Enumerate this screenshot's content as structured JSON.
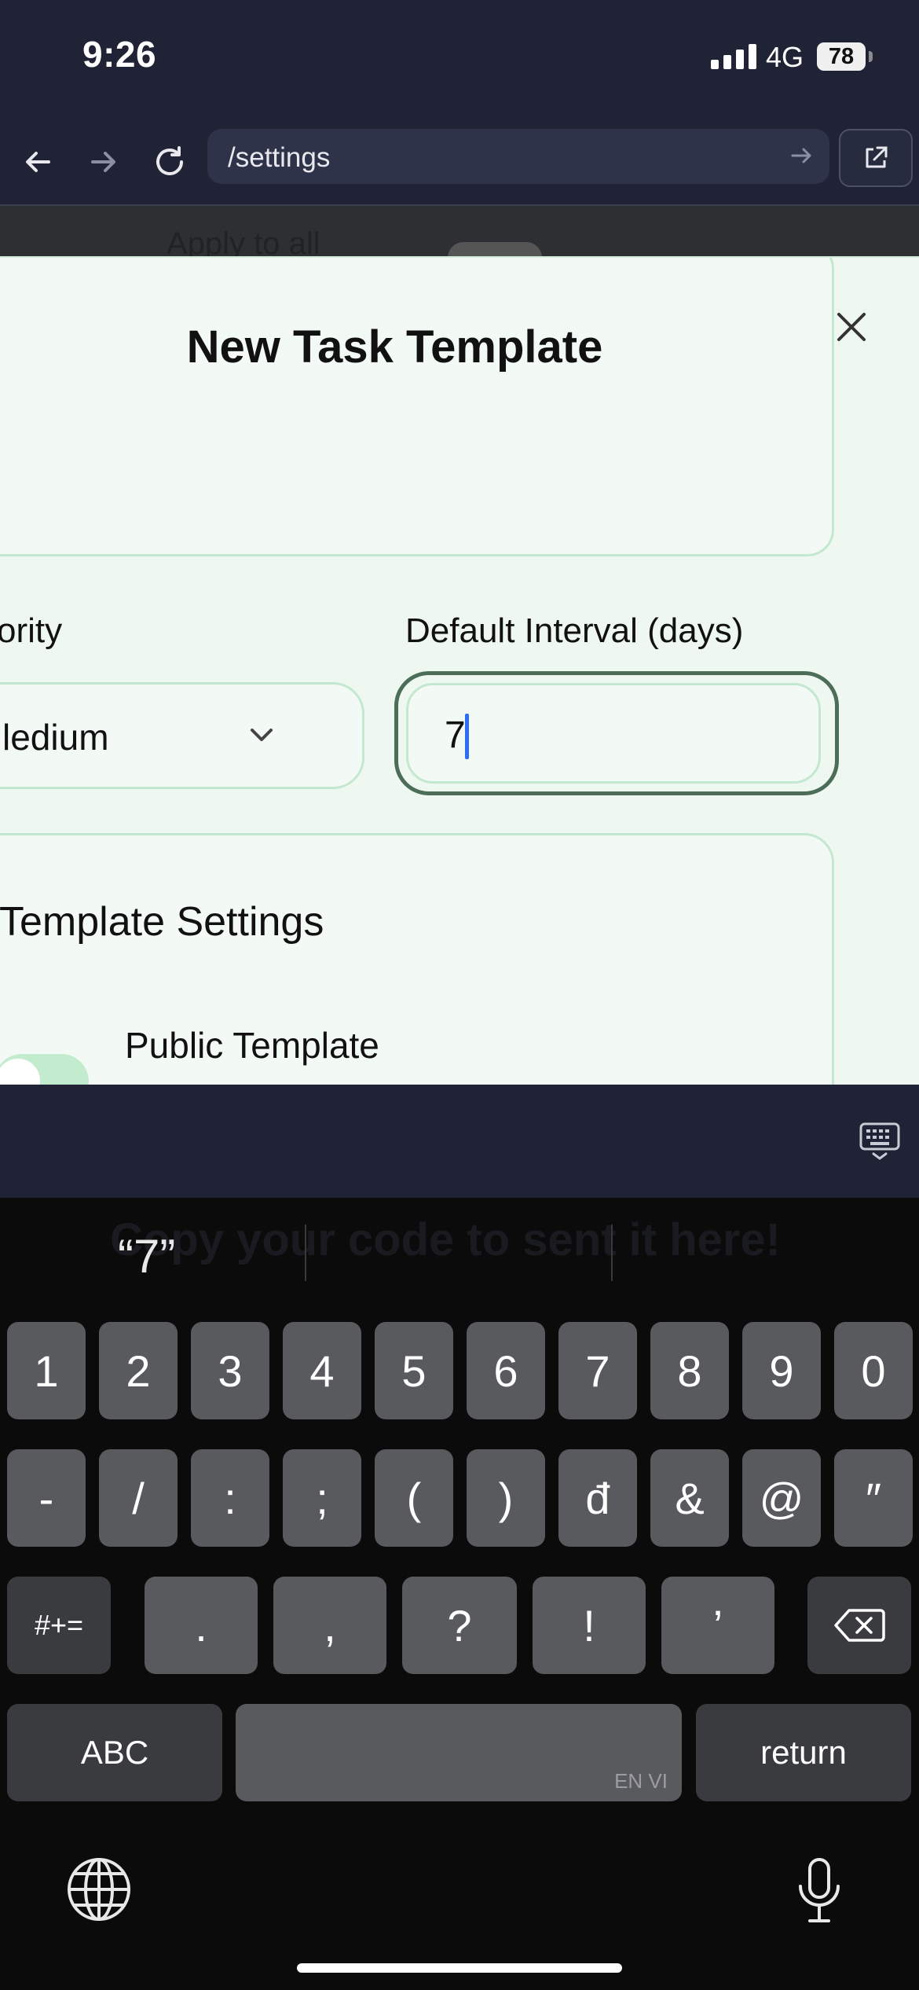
{
  "status_bar": {
    "time": "9:26",
    "network": "4G",
    "battery": "78"
  },
  "browser": {
    "url": "/settings"
  },
  "background": {
    "partial_text": "Apply to all"
  },
  "modal": {
    "title": "New Task Template",
    "priority": {
      "label": "Priority",
      "label_visible": "ority",
      "value": "Medium",
      "value_visible": "ledium"
    },
    "interval": {
      "label": "Default Interval (days)",
      "value": "7"
    },
    "template_settings": {
      "title_visible": "Template Settings",
      "public_label": "Public Template"
    }
  },
  "keyboard": {
    "ghost_text": "Copy your code to sent it here!",
    "suggestion": "“7”",
    "row1": [
      "1",
      "2",
      "3",
      "4",
      "5",
      "6",
      "7",
      "8",
      "9",
      "0"
    ],
    "row2": [
      "-",
      "/",
      ":",
      ";",
      "(",
      ")",
      "đ",
      "&",
      "@",
      "″"
    ],
    "row3": [
      "#+=",
      ".",
      ",",
      "?",
      "!",
      "’"
    ],
    "abc_label": "ABC",
    "space_lang": "EN VI",
    "return_label": "return"
  },
  "icons": {
    "back": "back-arrow-icon",
    "forward": "forward-arrow-icon",
    "reload": "reload-icon",
    "external": "external-link-icon",
    "close": "close-icon",
    "chevron": "chevron-down-icon",
    "keyboard_dismiss": "keyboard-dismiss-icon",
    "globe": "globe-icon",
    "mic": "microphone-icon",
    "delete": "delete-icon"
  },
  "colors": {
    "chrome": "#1f2335",
    "modal_bg": "#eef8f1",
    "field_border": "#c3e7cf",
    "focus_ring": "#4c6e58",
    "caret": "#2f6cf6"
  }
}
